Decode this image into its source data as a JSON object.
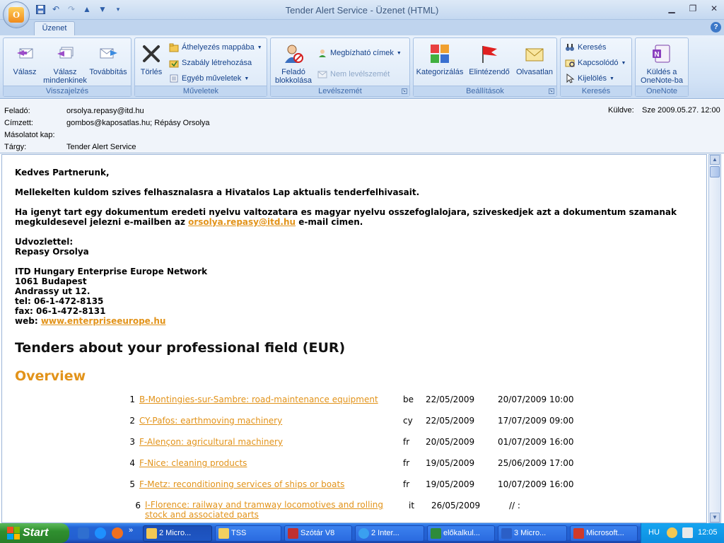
{
  "window": {
    "title": "Tender Alert Service - Üzenet (HTML)"
  },
  "ribbon": {
    "tab": "Üzenet",
    "groups": {
      "visszajelzes": {
        "label": "Visszajelzés",
        "reply": "Válasz",
        "reply_all": "Válasz mindenkinek",
        "forward": "Továbbítás"
      },
      "muveletek": {
        "label": "Műveletek",
        "delete": "Törlés",
        "move": "Áthelyezés mappába",
        "rule": "Szabály létrehozása",
        "other": "Egyéb műveletek"
      },
      "levelszemet": {
        "label": "Levélszemét",
        "block": "Feladó blokkolása",
        "trusted": "Megbízható címek",
        "not_junk": "Nem levélszemét"
      },
      "beallitasok": {
        "label": "Beállítások",
        "categorize": "Kategorizálás",
        "followup": "Elintézendő",
        "unread": "Olvasatlan"
      },
      "kereses": {
        "label": "Keresés",
        "find": "Keresés",
        "related": "Kapcsolódó",
        "select": "Kijelölés"
      },
      "onenote": {
        "label": "OneNote",
        "send": "Küldés a OneNote-ba"
      }
    }
  },
  "header": {
    "from_label": "Feladó:",
    "from": "orsolya.repasy@itd.hu",
    "to_label": "Címzett:",
    "to": "gombos@kaposatlas.hu; Répásy Orsolya",
    "cc_label": "Másolatot kap:",
    "subject_label": "Tárgy:",
    "subject": "Tender Alert Service",
    "sent_label": "Küldve:",
    "sent": "Sze 2009.05.27. 12:00"
  },
  "body": {
    "greeting": "Kedves Partnerunk,",
    "p1": "Mellekelten kuldom szives felhasznalasra a Hivatalos Lap aktualis tenderfelhivasait.",
    "p2a": "Ha igenyt tart egy dokumentum eredeti nyelvu valtozatara es magyar nyelvu osszefoglalojara, sziveskedjek azt a dokumentum szamanak",
    "p2b": "megkuldesevel jelezni e-mailben az",
    "p2_email": "orsolya.repasy@itd.hu",
    "p2c": "e-mail cimen.",
    "closing": "Udvozlettel:",
    "signature_name": "Repasy Orsolya",
    "org": "ITD Hungary Enterprise Europe Network",
    "address1": "1061 Budapest",
    "address2": "Andrassy ut 12.",
    "tel": "tel: 06-1-472-8135",
    "fax": "fax: 06-1-472-8131",
    "web_label": "web:",
    "web": "www.enterpriseeurope.hu",
    "heading": "Tenders about your professional field (EUR)",
    "overview": "Overview",
    "tenders": [
      {
        "num": "1",
        "title": "B-Montingies-sur-Sambre: road-maintenance equipment",
        "country": "be",
        "published": "22/05/2009",
        "deadline": "20/07/2009 10:00"
      },
      {
        "num": "2",
        "title": "CY-Pafos: earthmoving machinery",
        "country": "cy",
        "published": "22/05/2009",
        "deadline": "17/07/2009 09:00"
      },
      {
        "num": "3",
        "title": "F-Alençon: agricultural machinery",
        "country": "fr",
        "published": "20/05/2009",
        "deadline": "01/07/2009 16:00"
      },
      {
        "num": "4",
        "title": "F-Nice: cleaning products",
        "country": "fr",
        "published": "19/05/2009",
        "deadline": "25/06/2009 17:00"
      },
      {
        "num": "5",
        "title": "F-Metz: reconditioning services of ships or boats",
        "country": "fr",
        "published": "19/05/2009",
        "deadline": "10/07/2009 16:00"
      },
      {
        "num": "6",
        "title": "I-Florence: railway and tramway locomotives and rolling stock and associated parts",
        "country": "it",
        "published": "26/05/2009",
        "deadline": "// :"
      }
    ]
  },
  "taskbar": {
    "start": "Start",
    "tasks": [
      "2 Micro...",
      "TSS",
      "Szótár V8",
      "2 Inter...",
      "előkalkul...",
      "3 Micro...",
      "Microsoft..."
    ],
    "lang": "HU",
    "clock": "12:05"
  },
  "colors": {
    "link": "#e2931a",
    "ribbon_text": "#15428b"
  }
}
